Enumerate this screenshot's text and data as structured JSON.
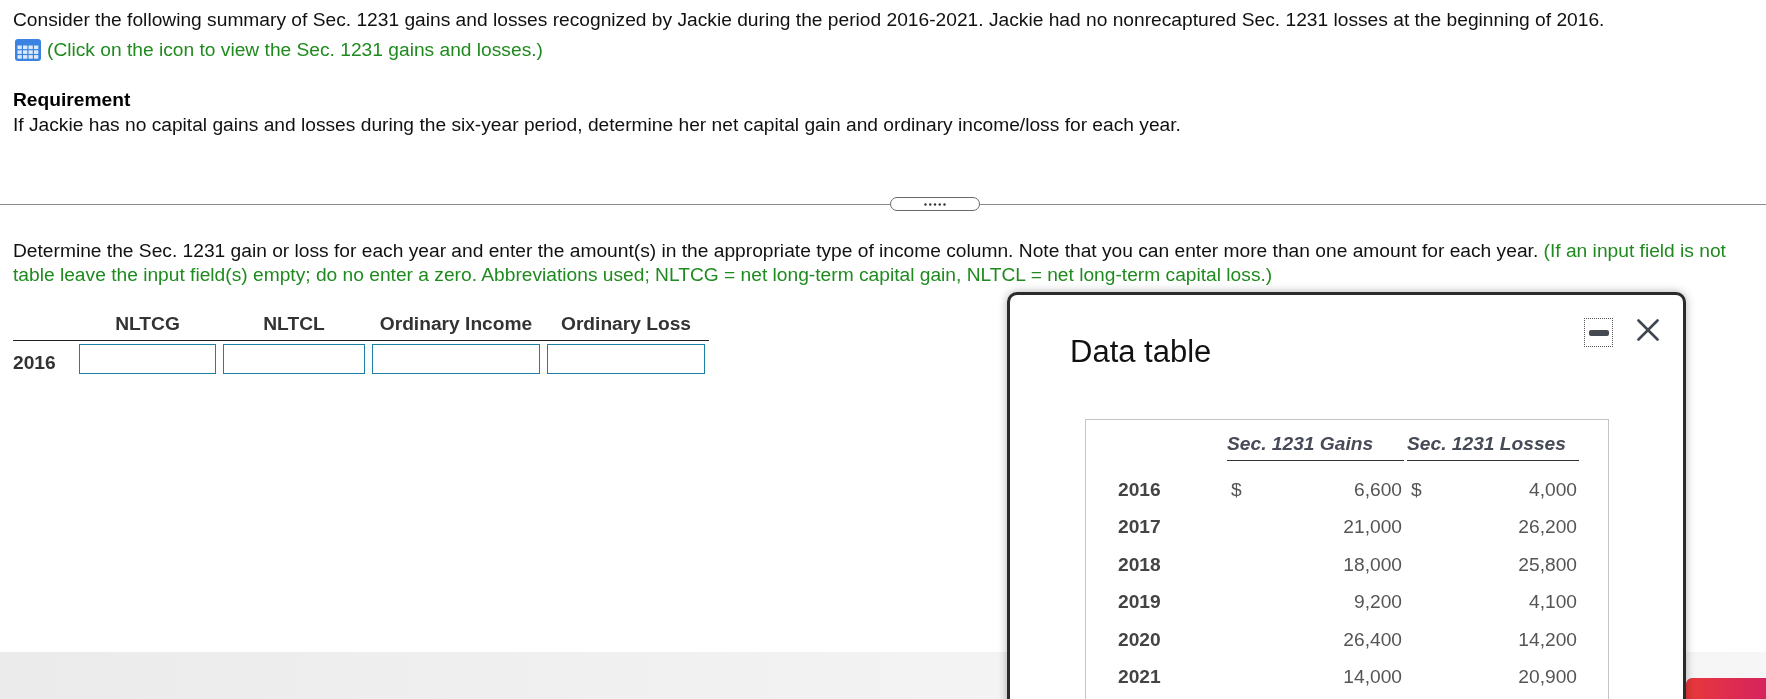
{
  "intro": {
    "text": "Consider the following summary of Sec. 1231 gains and losses recognized by Jackie during the period 2016-2021. Jackie had no nonrecaptured Sec. 1231 losses at the beginning of 2016.",
    "link": "(Click on the icon to view the Sec. 1231 gains and losses.)"
  },
  "requirement": {
    "heading": "Requirement",
    "text": "If Jackie has no capital gains and losses during the six-year period, determine her net capital gain and ordinary income/loss for each year."
  },
  "instruction": {
    "text": "Determine the Sec. 1231 gain or loss for each year and enter the amount(s) in the appropriate type of income column. Note that you can enter more than one amount for each year.",
    "note_start": "(If an input field is not",
    "note_rest": "table leave the input field(s) empty; do no enter a zero. Abbreviations used; NLTCG = net long-term capital gain, NLTCL = net long-term capital loss.)"
  },
  "answer_table": {
    "columns": [
      "NLTCG",
      "NLTCL",
      "Ordinary Income",
      "Ordinary Loss"
    ],
    "rows": [
      {
        "year": "2016"
      }
    ]
  },
  "data_table": {
    "title": "Data table",
    "columns": [
      "Sec. 1231 Gains",
      "Sec. 1231 Losses"
    ],
    "rows": [
      {
        "year": "2016",
        "gains_currency": "$",
        "gains": "6,600",
        "losses_currency": "$",
        "losses": "4,000"
      },
      {
        "year": "2017",
        "gains": "21,000",
        "losses": "26,200"
      },
      {
        "year": "2018",
        "gains": "18,000",
        "losses": "25,800"
      },
      {
        "year": "2019",
        "gains": "9,200",
        "losses": "4,100"
      },
      {
        "year": "2020",
        "gains": "26,400",
        "losses": "14,200"
      },
      {
        "year": "2021",
        "gains": "14,000",
        "losses": "20,900"
      }
    ]
  }
}
